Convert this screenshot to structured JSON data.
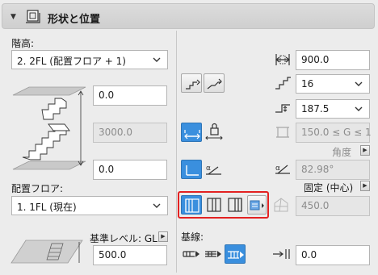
{
  "panel": {
    "title": "形状と位置"
  },
  "left": {
    "story_label": "階高:",
    "story_value": "2. 2FL (配置フロア + 1)",
    "top_offset": "0.0",
    "height_value": "3000.0",
    "bottom_offset": "0.0",
    "home_floor_label": "配置フロア:",
    "home_floor_value": "1. 1FL (現在)",
    "ref_level_label": "基準レベル: GL",
    "ref_level_value": "500.0"
  },
  "mid": {
    "baseline_label": "基線:"
  },
  "right": {
    "width_value": "900.0",
    "risers_value": "16",
    "riser_height_value": "187.5",
    "goal_rule_value": "150.0 ≤ G ≤ 1",
    "angle_label": "角度",
    "angle_value": "82.98°",
    "fixed_label": "固定 (中心)",
    "fixed_value": "450.0",
    "baseline_offset_value": "0.0"
  }
}
